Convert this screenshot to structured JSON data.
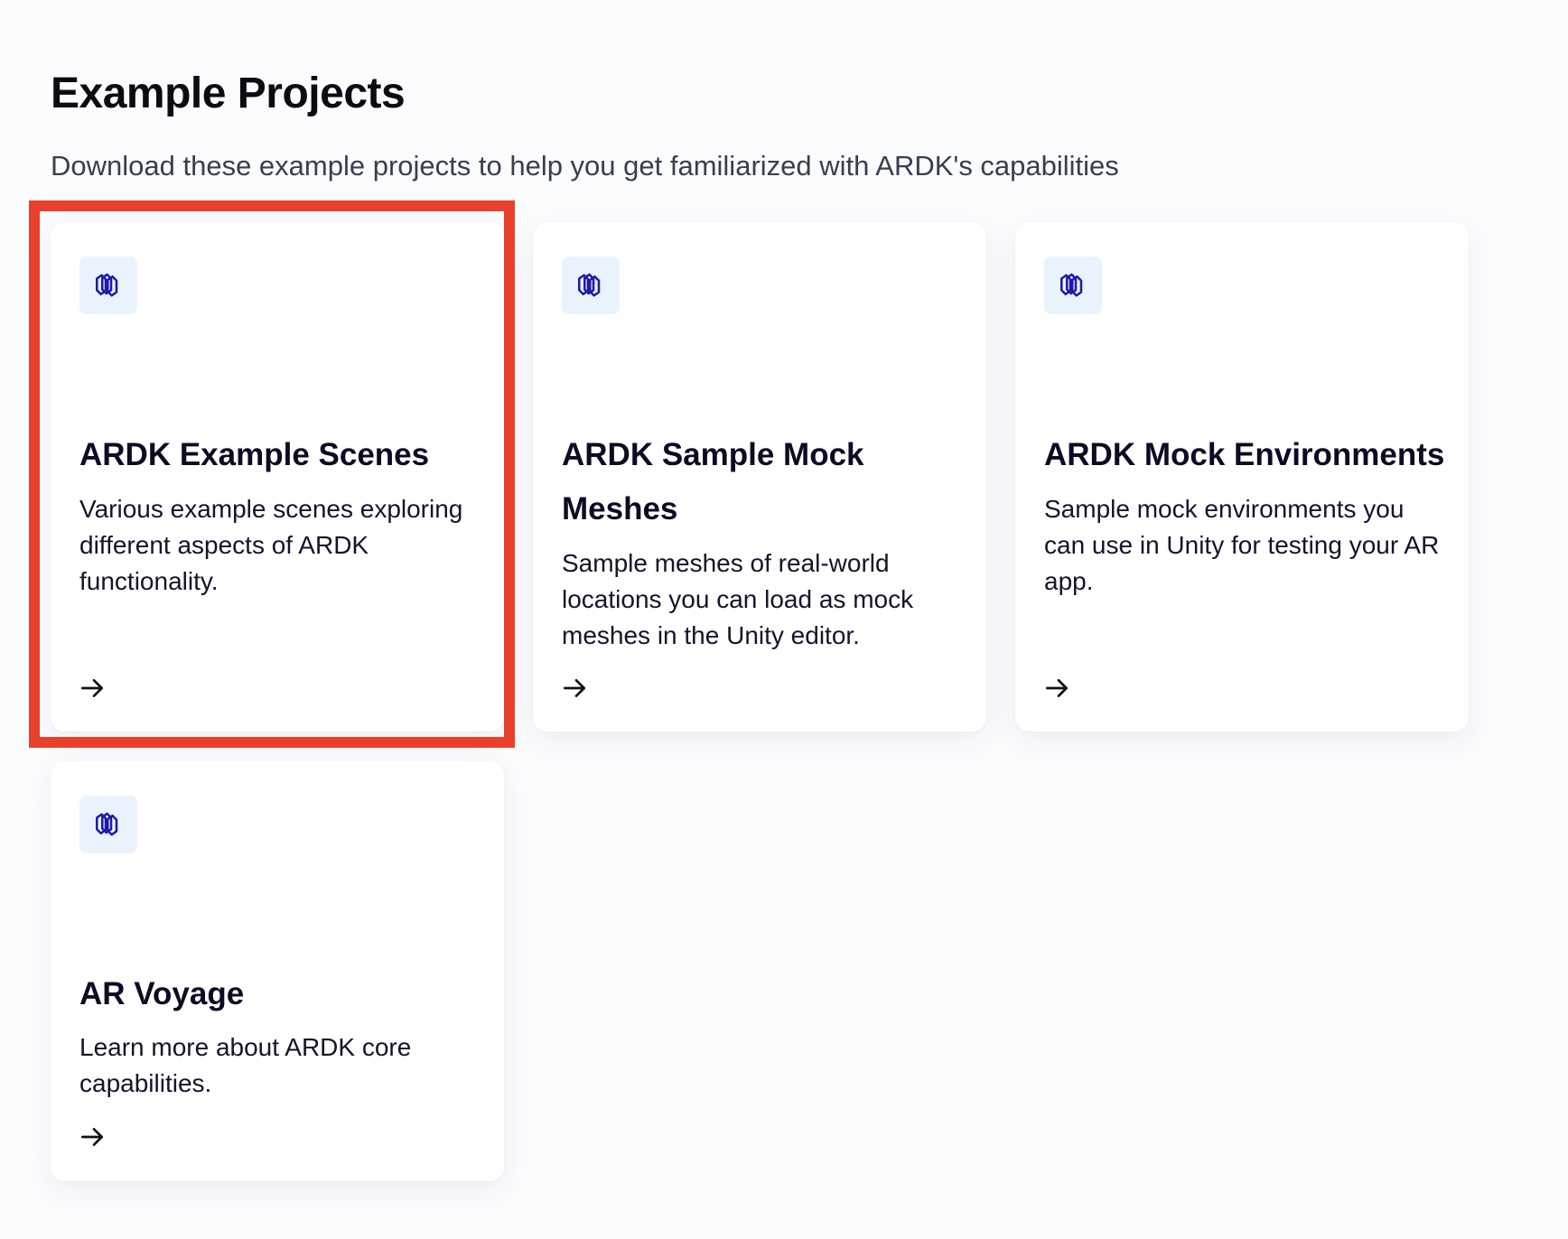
{
  "header": {
    "title": "Example Projects",
    "subtitle": "Download these example projects to help you get familiarized with ARDK's capabilities"
  },
  "cards": [
    {
      "icon": "stacked-layers-icon",
      "title": "ARDK Example Scenes",
      "description": "Various example scenes exploring different aspects of ARDK functionality.",
      "link_icon": "arrow-right-icon",
      "highlighted": true
    },
    {
      "icon": "stacked-layers-icon",
      "title": "ARDK Sample Mock Meshes",
      "description": "Sample meshes of real-world locations you can load as mock meshes in the Unity editor.",
      "link_icon": "arrow-right-icon",
      "highlighted": false
    },
    {
      "icon": "stacked-layers-icon",
      "title": "ARDK Mock Environments",
      "description": "Sample mock environments you can use in Unity for testing your AR app.",
      "link_icon": "arrow-right-icon",
      "highlighted": false
    },
    {
      "icon": "stacked-layers-icon",
      "title": "AR Voyage",
      "description": "Learn more about ARDK core capabilities.",
      "link_icon": "arrow-right-icon",
      "highlighted": false
    }
  ],
  "colors": {
    "background": "#fbfcfe",
    "card_background": "#ffffff",
    "icon_tile": "#eaf3fd",
    "icon_stroke": "#1e1aa8",
    "heading_text": "#0d0b24",
    "highlight_border": "#e8402c"
  }
}
